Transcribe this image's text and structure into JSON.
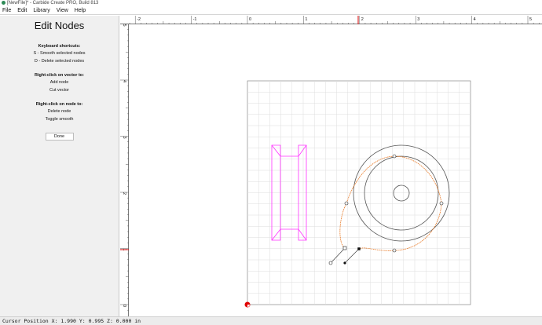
{
  "window": {
    "title": "[NewFile]* - Carbide Create PRO, Build 813"
  },
  "menu": {
    "items": [
      "File",
      "Edit",
      "Library",
      "View",
      "Help"
    ]
  },
  "panel": {
    "title": "Edit Nodes",
    "shortcuts_heading": "Keyboard shortcuts:",
    "shortcut_smooth": "S - Smooth selected nodes",
    "shortcut_delete": "D - Delete selected nodes",
    "vector_heading": "Right-click on vector to:",
    "vector_add": "Add node",
    "vector_cut": "Cut vector",
    "node_heading": "Right-click on node to:",
    "node_delete": "Delete node",
    "node_toggle": "Toggle smooth",
    "done_label": "Done"
  },
  "ruler": {
    "x_labels": [
      "-2",
      "-1",
      "0",
      "1",
      "2",
      "3",
      "4",
      "5"
    ],
    "y_labels": [
      "5",
      "4",
      "3",
      "2",
      "1",
      "0"
    ],
    "marker_color": "#d40000"
  },
  "status": {
    "cursor_text": "Cursor Position X: 1.990 Y: 0.995 Z: 0.000 in"
  },
  "colors": {
    "stock_grid": "#dddddd",
    "magenta_path": "#ff33ff",
    "orange_path": "#e87722",
    "circle_stroke": "#555555"
  }
}
